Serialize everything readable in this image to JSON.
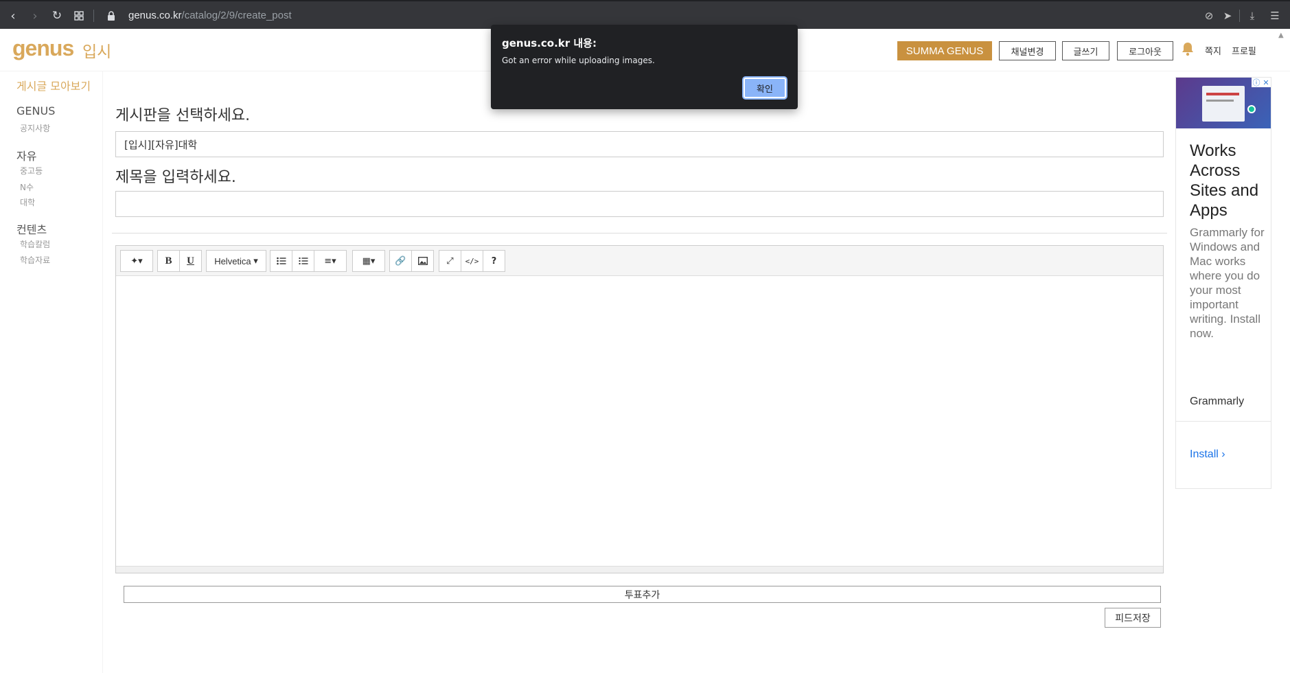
{
  "browser": {
    "url_host": "genus.co.kr",
    "url_path": "/catalog/2/9/create_post"
  },
  "header": {
    "logo_text": "genus",
    "logo_sub": "입시",
    "summa_label": "SUMMA GENUS",
    "channel_label": "채널변경",
    "write_label": "글쓰기",
    "logout_label": "로그아웃",
    "message_label": "쪽지",
    "profile_label": "프로필"
  },
  "sidebar": {
    "all_posts": "게시글 모아보기",
    "groups": [
      {
        "title": "GENUS",
        "items": [
          "공지사항"
        ]
      },
      {
        "title": "자유",
        "items": [
          "중고등",
          "N수",
          "대학"
        ]
      },
      {
        "title": "컨텐츠",
        "items": [
          "학습칼럼",
          "학습자료"
        ]
      }
    ]
  },
  "form": {
    "board_label": "게시판을 선택하세요.",
    "board_value": "[입시][자유]대학",
    "title_label": "제목을 입력하세요.",
    "title_value": "",
    "font_name": "Helvetica",
    "vote_label": "투표추가",
    "save_label": "피드저장"
  },
  "ad": {
    "headline": "Works Across Sites and Apps",
    "body": "Grammarly for Windows and Mac works where you do your most important writing. Install now.",
    "brand": "Grammarly",
    "cta": "Install"
  },
  "dialog": {
    "title": "genus.co.kr 내용:",
    "message": "Got an error while uploading images.",
    "ok_label": "확인"
  },
  "colors": {
    "brand_gold": "#c9913f",
    "logo_gold": "#d9a85b",
    "dialog_bg": "#202124",
    "dialog_button": "#8ab4f8",
    "ad_link": "#1a73e8"
  }
}
